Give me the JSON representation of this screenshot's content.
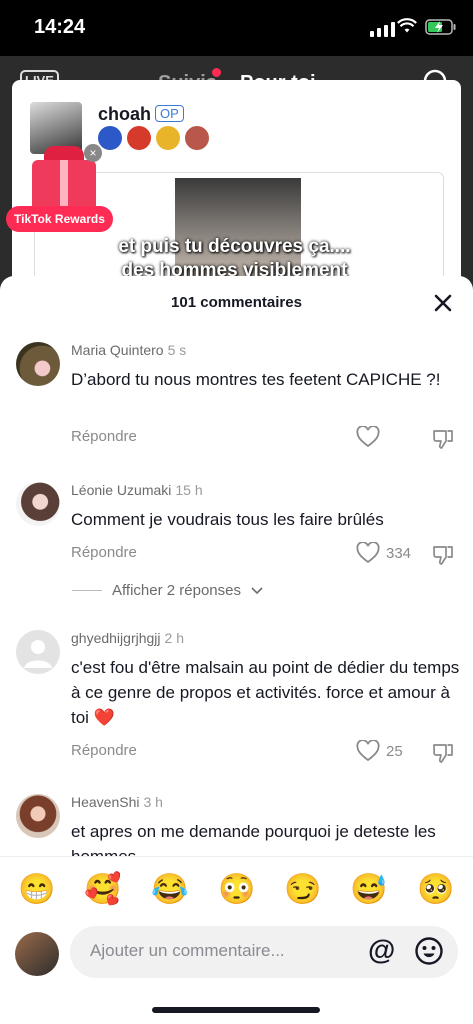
{
  "status_bar": {
    "time": "14:24"
  },
  "top_nav": {
    "live_label": "LIVE",
    "tab_following": "Suivis",
    "tab_for_you": "Pour toi"
  },
  "post": {
    "username": "choah",
    "op_badge": "OP",
    "caption_line1": "et puis tu découvres ça....",
    "caption_line2": "des hommes visiblement"
  },
  "rewards": {
    "label": "TikTok Rewards"
  },
  "sheet": {
    "title": "101 commentaires",
    "comments": [
      {
        "author": "Maria Quintero",
        "time": "5 s",
        "text": "D’abord tu nous montres tes feetent CAPICHE ?!",
        "reply": "Répondre",
        "likes": ""
      },
      {
        "author": "Léonie Uzumaki",
        "time": "15 h",
        "text": "Comment je voudrais tous les faire brûlés",
        "reply": "Répondre",
        "likes": "334"
      },
      {
        "author": "ghyedhijgrjhgjj",
        "time": "2 h",
        "text": "c'est fou d'être malsain au point de dédier du temps à ce genre de propos et activités. force et amour à toi ❤️",
        "reply": "Répondre",
        "likes": "25"
      },
      {
        "author": "HeavenShi",
        "time": "3 h",
        "text": "et apres on me demande pourquoi je deteste les hommes",
        "reply": "",
        "likes": ""
      }
    ],
    "show_replies": "Afficher 2 réponses"
  },
  "emoji_bar": [
    "😁",
    "🥰",
    "😂",
    "😳",
    "😏",
    "😅",
    "🥺"
  ],
  "composer": {
    "placeholder": "Ajouter un commentaire...",
    "at_symbol": "@"
  },
  "colors": {
    "accent": "#fe2c55",
    "op_blue": "#3b7bd6",
    "heart_red": "#e53935"
  }
}
